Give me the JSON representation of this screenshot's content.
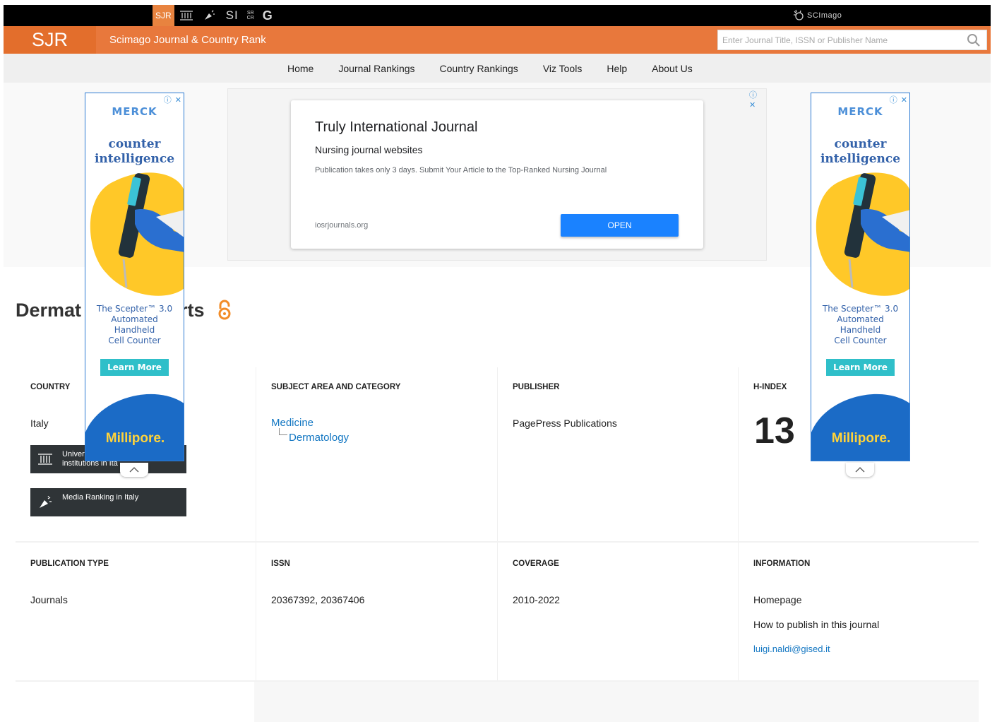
{
  "topbar": {
    "sites": [
      "SJR",
      "institutions-icon",
      "media-icon",
      "SI",
      "SR CR",
      "G"
    ],
    "sjr_label": "SJR",
    "si_label": "SI",
    "srcr_label": "SR\nCR",
    "g_label": "G",
    "scimago_label": "SCImago"
  },
  "header": {
    "logo": "SJR",
    "title": "Scimago Journal & Country Rank",
    "search_placeholder": "Enter Journal Title, ISSN or Publisher Name"
  },
  "nav": {
    "items": [
      "Home",
      "Journal Rankings",
      "Country Rankings",
      "Viz Tools",
      "Help",
      "About Us"
    ]
  },
  "ad": {
    "headline": "Truly International Journal",
    "subheadline": "Nursing journal websites",
    "description": "Publication takes only 3 days. Submit Your Article to the Top-Ranked Nursing Journal",
    "url": "iosrjournals.org",
    "button": "OPEN",
    "close": "ⓘ ✕"
  },
  "side_ad": {
    "brand": "MERCK",
    "slogan_1": "counter",
    "slogan_2": "intelligence",
    "desc_1": "The Scepter™ 3.0",
    "desc_2": "Automated",
    "desc_3": "Handheld",
    "desc_4": "Cell Counter",
    "learn": "Learn More",
    "brand2": "Millipore.",
    "close": "ⓘ ✕"
  },
  "journal": {
    "title_visible_start": "Dermat",
    "title_visible_end": "rts"
  },
  "info": {
    "country_label": "COUNTRY",
    "country": "Italy",
    "univ_btn_1": "Univer",
    "univ_btn_2": "institutions in Ita",
    "media_btn": "Media Ranking in Italy",
    "subject_label": "SUBJECT AREA AND CATEGORY",
    "subject": "Medicine",
    "category": "Dermatology",
    "publisher_label": "PUBLISHER",
    "publisher": "PagePress Publications",
    "hindex_label": "H-INDEX",
    "hindex": "13",
    "pubtype_label": "PUBLICATION TYPE",
    "pubtype": "Journals",
    "issn_label": "ISSN",
    "issn": "20367392, 20367406",
    "coverage_label": "COVERAGE",
    "coverage": "2010-2022",
    "information_label": "INFORMATION",
    "homepage": "Homepage",
    "howto": "How to publish in this journal",
    "email": "luigi.naldi@gised.it"
  },
  "colors": {
    "orange": "#e8783c",
    "orange_dark": "#e36e2c",
    "link": "#1276c2",
    "dark_button": "#2f3437"
  }
}
